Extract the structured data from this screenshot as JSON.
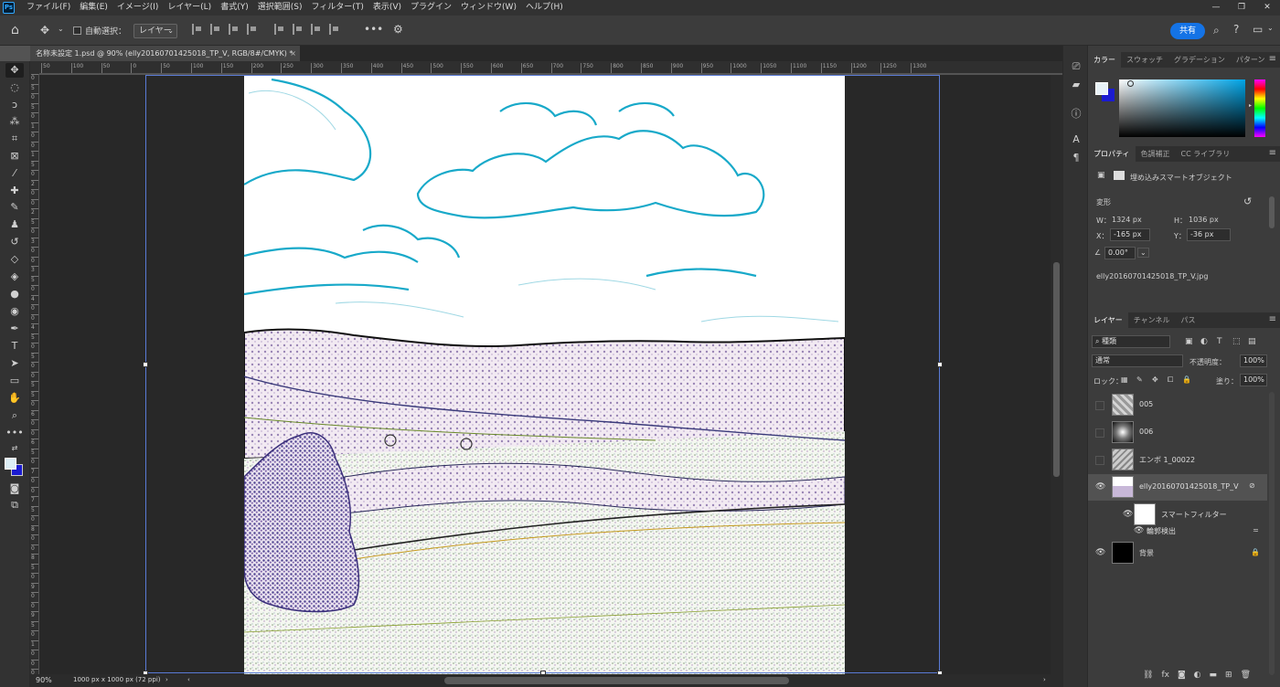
{
  "app": {
    "logo": "Ps"
  },
  "menu": [
    "ファイル(F)",
    "編集(E)",
    "イメージ(I)",
    "レイヤー(L)",
    "書式(Y)",
    "選択範囲(S)",
    "フィルター(T)",
    "表示(V)",
    "プラグイン",
    "ウィンドウ(W)",
    "ヘルプ(H)"
  ],
  "window_controls": {
    "minimize": "—",
    "maximize": "❐",
    "close": "✕"
  },
  "options": {
    "auto_select_label": "自動選択：",
    "layer_select_value": "レイヤー",
    "share_label": "共有"
  },
  "document": {
    "tab_title": "名称未設定 1.psd @ 90% (elly20160701425018_TP_V, RGB/8#/CMYK) *",
    "tab_close": "×"
  },
  "rulers": {
    "h_ticks": [
      "50",
      "100",
      "50",
      "0",
      "50",
      "100",
      "150",
      "200",
      "250",
      "300",
      "350",
      "400",
      "450",
      "500",
      "550",
      "600",
      "650",
      "700",
      "750",
      "800",
      "850",
      "900",
      "950",
      "1000",
      "1050",
      "1100",
      "1150",
      "1200",
      "1250",
      "1300"
    ],
    "v_ticks": [
      "0",
      "5",
      "0",
      "5",
      "0",
      "1",
      "0",
      "0",
      "1",
      "5",
      "0",
      "2",
      "0",
      "0",
      "2",
      "5",
      "0",
      "3",
      "0",
      "0",
      "3",
      "5",
      "0",
      "4",
      "0",
      "0",
      "4",
      "5",
      "0",
      "5",
      "0",
      "0",
      "5",
      "5",
      "0",
      "6",
      "0",
      "0",
      "6",
      "5",
      "0",
      "7",
      "0",
      "0",
      "7",
      "5",
      "0",
      "8",
      "0",
      "0",
      "8",
      "5",
      "0",
      "9",
      "0",
      "0",
      "9",
      "5",
      "0",
      "1",
      "0",
      "0",
      "0"
    ]
  },
  "status": {
    "zoom": "90%",
    "doc_size": "1000 px x 1000 px (72 ppi)"
  },
  "color_panel": {
    "tabs": [
      "カラー",
      "スウォッチ",
      "グラデーション",
      "パターン"
    ],
    "foreground": "#e8f2f7",
    "background": "#1b1bd0"
  },
  "properties_panel": {
    "tabs": [
      "プロパティ",
      "色調補正",
      "CC ライブラリ"
    ],
    "object_type": "埋め込みスマートオブジェクト",
    "section": "変形",
    "w_label": "W：",
    "w_value": "1324 px",
    "h_label": "H：",
    "h_value": "1036 px",
    "x_label": "X：",
    "x_value": "-165 px",
    "y_label": "Y：",
    "y_value": "-36 px",
    "angle_value": "0.00°",
    "filename": "elly20160701425018_TP_V.jpg"
  },
  "layers_panel": {
    "tabs": [
      "レイヤー",
      "チャンネル",
      "パス"
    ],
    "filter_label": "種類",
    "blend_mode": "通常",
    "opacity_label": "不透明度：",
    "opacity_value": "100%",
    "lock_label": "ロック：",
    "fill_label": "塗り：",
    "fill_value": "100%",
    "layers": [
      {
        "name": "005",
        "visible": false
      },
      {
        "name": "006",
        "visible": false
      },
      {
        "name": "エンボ 1_00022",
        "visible": false
      },
      {
        "name": "elly20160701425018_TP_V",
        "visible": true,
        "selected": true
      },
      {
        "name": "スマートフィルター",
        "visible": true
      },
      {
        "name": "輪郭検出",
        "visible": true
      },
      {
        "name": "背景",
        "visible": true
      }
    ]
  }
}
